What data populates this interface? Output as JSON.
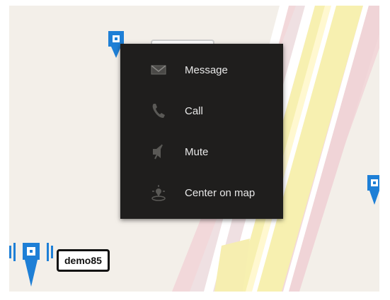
{
  "context_menu": {
    "items": [
      {
        "label": "Message",
        "icon": "envelope-icon"
      },
      {
        "label": "Call",
        "icon": "phone-icon"
      },
      {
        "label": "Mute",
        "icon": "mute-speaker-icon"
      },
      {
        "label": "Center on map",
        "icon": "center-map-icon"
      }
    ]
  },
  "markers": [
    {
      "label": "demo85",
      "icon": "user-location-pin-icon",
      "state": "speaking"
    }
  ],
  "colors": {
    "marker_blue": "#1e7fd6",
    "menu_background": "#1f1e1d",
    "road_yellow": "#f7f0b0",
    "road_pink": "#f3d9db",
    "map_background": "#f3efe9"
  }
}
